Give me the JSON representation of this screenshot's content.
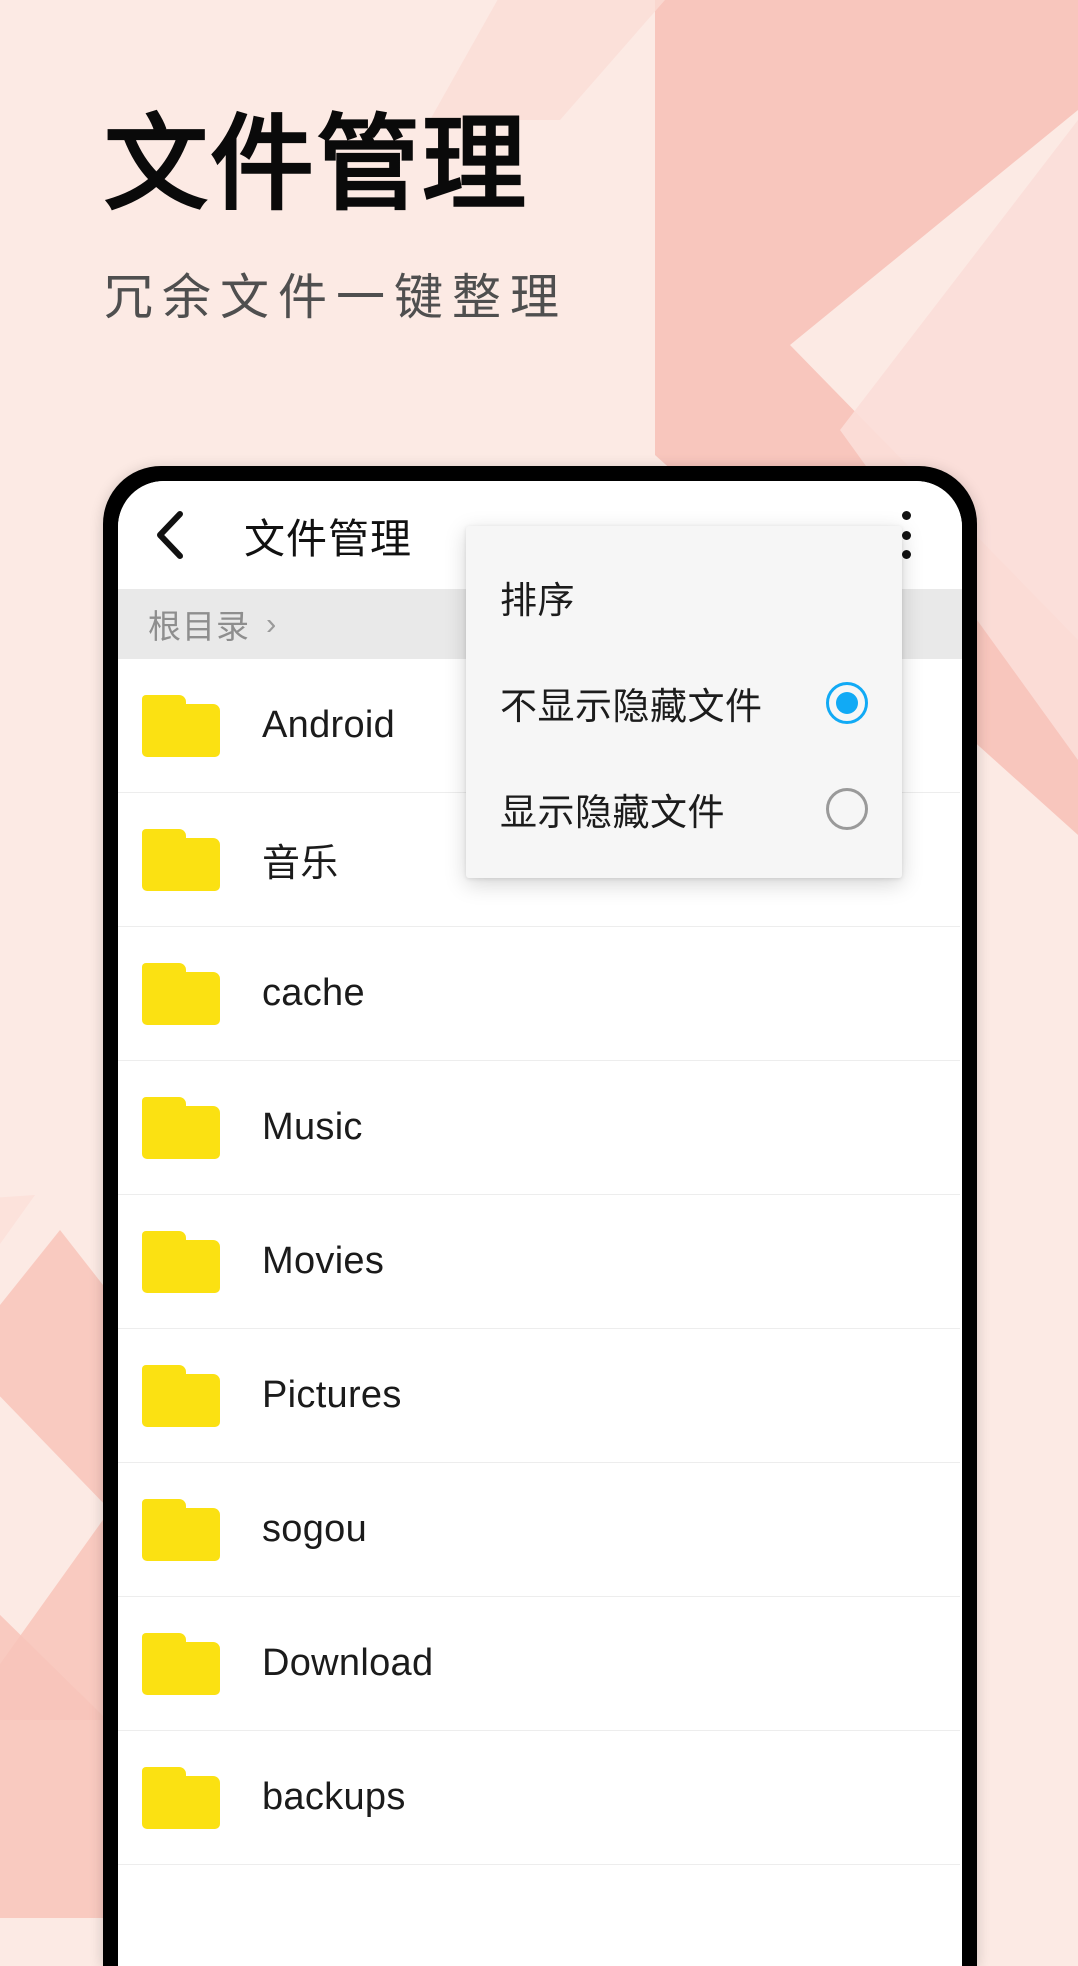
{
  "promo": {
    "title": "文件管理",
    "subtitle": "冗余文件一键整理",
    "title_color": "#0a0a0a",
    "subtitle_color": "#4f4f4f",
    "background_color": "#fceae4",
    "accent_shape_color": "#f8c4ba"
  },
  "app": {
    "header": {
      "back_icon": "chevron-left-icon",
      "title": "文件管理",
      "overflow_icon": "kebab-menu-icon"
    },
    "breadcrumb": {
      "items": [
        {
          "label": "根目录"
        }
      ],
      "separator": "›"
    },
    "files": [
      {
        "name": "Android",
        "icon": "folder-icon"
      },
      {
        "name": "音乐",
        "icon": "folder-icon"
      },
      {
        "name": "cache",
        "icon": "folder-icon"
      },
      {
        "name": "Music",
        "icon": "folder-icon"
      },
      {
        "name": "Movies",
        "icon": "folder-icon"
      },
      {
        "name": "Pictures",
        "icon": "folder-icon"
      },
      {
        "name": "sogou",
        "icon": "folder-icon"
      },
      {
        "name": "Download",
        "icon": "folder-icon"
      },
      {
        "name": "backups",
        "icon": "folder-icon"
      }
    ],
    "overflow_menu": {
      "items": [
        {
          "label": "排序",
          "type": "action",
          "selected": false
        },
        {
          "label": "不显示隐藏文件",
          "type": "radio",
          "selected": true
        },
        {
          "label": "显示隐藏文件",
          "type": "radio",
          "selected": false
        }
      ],
      "selected_color": "#11aaf5",
      "unselected_color": "#9a9a9a"
    },
    "folder_color": "#fbe112"
  }
}
